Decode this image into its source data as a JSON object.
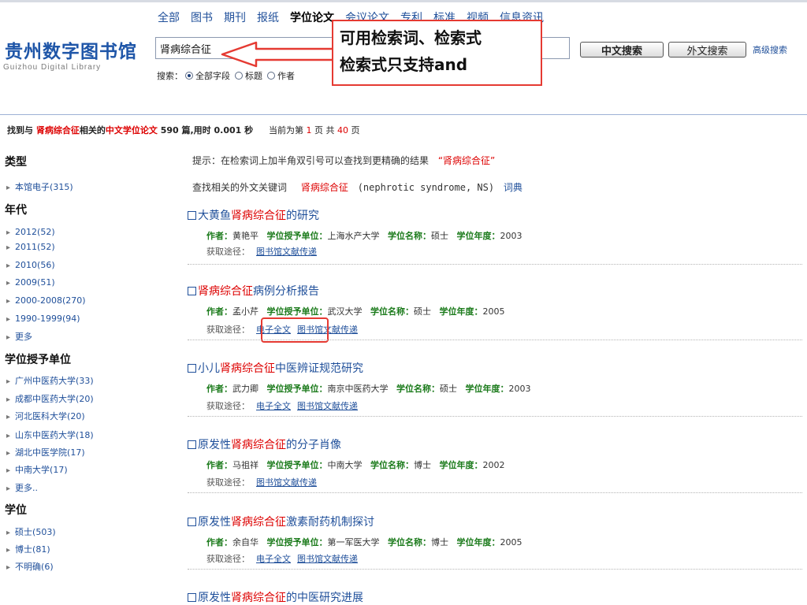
{
  "logo": {
    "cn": "贵州数字图书馆",
    "en": "Guizhou Digital Library"
  },
  "nav": [
    "全部",
    "图书",
    "期刊",
    "报纸",
    "学位论文",
    "会议论文",
    "专利",
    "标准",
    "视频",
    "信息资讯"
  ],
  "search": {
    "value": "肾病综合征",
    "btn_cn": "中文搜索",
    "btn_ext": "外文搜索",
    "advanced": "高级搜索"
  },
  "scope": {
    "label": "搜索：",
    "options": [
      "全部字段",
      "标题",
      "作者"
    ],
    "selected": "全部字段"
  },
  "callout": {
    "line1": "可用检索词、检索式",
    "line2": "检索式只支持and"
  },
  "summary": {
    "prefix": "找到与",
    "keyword": "肾病综合征",
    "mid": "相关的",
    "type": "中文学位论文",
    "count": "590 篇,用时 0.001 秒",
    "page_pre": "当前为第",
    "page": "1",
    "page_mid": "页 共",
    "total": "40",
    "page_post": "页"
  },
  "tip": {
    "text": "提示：在检索词上加半角双引号可以查找到更精确的结果",
    "quoted": "“肾病综合征”"
  },
  "ext_kw": {
    "label": "查找相关的外文关键词",
    "kw": "肾病综合征",
    "trans": "(nephrotic syndrome, NS)",
    "dict": "词典"
  },
  "sidebar": {
    "type_head": "类型",
    "type_items": [
      "本馆电子(315)"
    ],
    "year_head": "年代",
    "year_items": [
      "2012(52)",
      "2011(52)",
      "2010(56)",
      "2009(51)",
      "2000-2008(270)",
      "1990-1999(94)",
      "更多"
    ],
    "unit_head": "学位授予单位",
    "unit_items": [
      "广州中医药大学(33)",
      "成都中医药大学(20)",
      "河北医科大学(20)",
      "山东中医药大学(18)",
      "湖北中医学院(17)",
      "中南大学(17)",
      "更多.."
    ],
    "degree_head": "学位",
    "degree_items": [
      "硕士(503)",
      "博士(81)",
      "不明确(6)"
    ]
  },
  "labels": {
    "author": "作者：",
    "unit": "学位授予单位：",
    "degree": "学位名称：",
    "year": "学位年度：",
    "access": "获取途径：",
    "fulltext": "电子全文",
    "delivery": "图书馆文献传递"
  },
  "results": [
    {
      "pre": "大黄鱼",
      "hl": "肾病综合征",
      "post": "的研究",
      "author": "黄艳平",
      "unit": "上海水产大学",
      "degree": "硕士",
      "year": "2003",
      "fulltext": false
    },
    {
      "pre": "",
      "hl": "肾病综合征",
      "post": "病例分析报告",
      "author": "孟小芹",
      "unit": "武汉大学",
      "degree": "硕士",
      "year": "2005",
      "fulltext": true
    },
    {
      "pre": "小儿",
      "hl": "肾病综合征",
      "post": "中医辨证规范研究",
      "author": "武力卿",
      "unit": "南京中医药大学",
      "degree": "硕士",
      "year": "2003",
      "fulltext": true
    },
    {
      "pre": "原发性",
      "hl": "肾病综合征",
      "post": "的分子肖像",
      "author": "马祖祥",
      "unit": "中南大学",
      "degree": "博士",
      "year": "2002",
      "fulltext": false
    },
    {
      "pre": "原发性",
      "hl": "肾病综合征",
      "post": "激素耐药机制探讨",
      "author": "余自华",
      "unit": "第一军医大学",
      "degree": "博士",
      "year": "2005",
      "fulltext": true
    },
    {
      "pre": "原发性",
      "hl": "肾病综合征",
      "post": "的中医研究进展"
    }
  ]
}
